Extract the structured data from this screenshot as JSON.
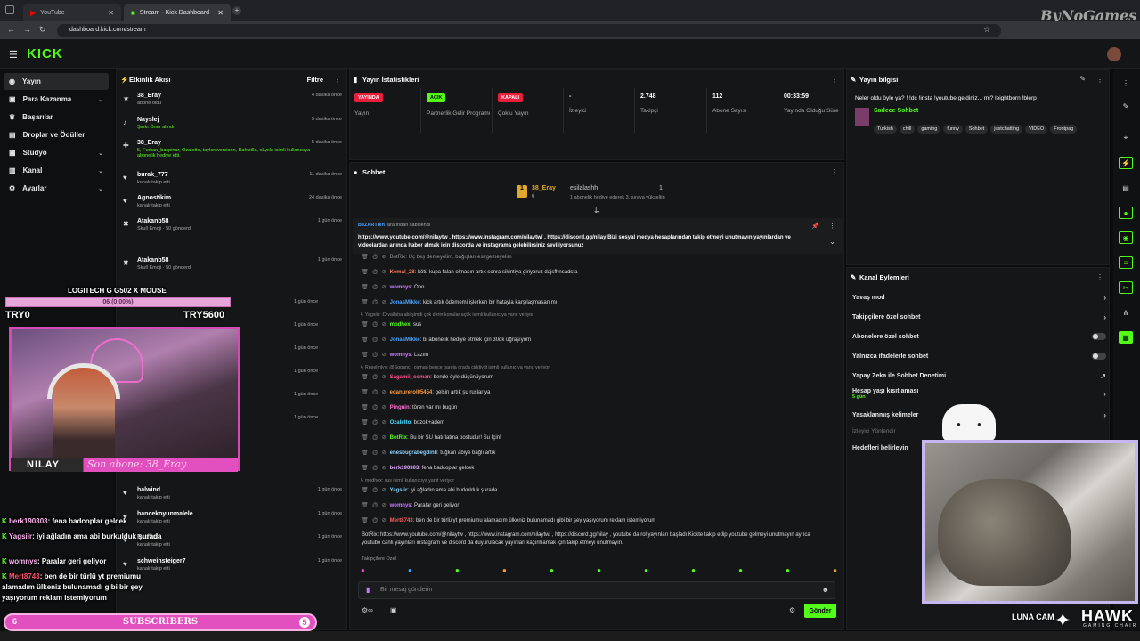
{
  "browser": {
    "tabs": [
      {
        "label": "YouTube"
      },
      {
        "label": "Stream - Kick Dashboard"
      }
    ],
    "url": "dashboard.kick.com/stream"
  },
  "brand": {
    "logo": "KICK"
  },
  "sidebar": {
    "items": [
      {
        "label": "Yayın",
        "icon": "broadcast-icon"
      },
      {
        "label": "Para Kazanma",
        "icon": "money-icon"
      },
      {
        "label": "Başarılar",
        "icon": "trophy-icon"
      },
      {
        "label": "Droplar ve Ödüller",
        "icon": "gift-icon"
      },
      {
        "label": "Stüdyo",
        "icon": "studio-icon"
      },
      {
        "label": "Kanal",
        "icon": "channel-icon"
      },
      {
        "label": "Ayarlar",
        "icon": "gear-icon"
      }
    ]
  },
  "activity": {
    "title": "Etkinlik Akışı",
    "filter": "Filtre",
    "items": [
      {
        "name": "38_Eray",
        "sub": "abone oldu",
        "time": "4 dakika önce"
      },
      {
        "name": "Nayslej",
        "sub": "Şarkı Öner alındı",
        "time": "5 dakika önce"
      },
      {
        "name": "38_Eray",
        "sub": "5, Furkan_baspinar, Ozaletto, taylorsversionn, Bahtzilla, xLyxla isimli kullanıcıya abonelik hediye etti.",
        "time": "5 dakika önce"
      },
      {
        "name": "burak_777",
        "sub": "kanalı takip etti",
        "time": "11 dakika önce"
      },
      {
        "name": "Agnostikim",
        "sub": "kanalı takip etti",
        "time": "24 dakika önce"
      },
      {
        "name": "Atakanb58",
        "sub": "Skull Emoji · 50 gönderdi",
        "time": "1 gün önce"
      },
      {
        "name": "Atakanb58",
        "sub": "Skull Emoji · 50 gönderdi",
        "time": "1 gün önce"
      },
      {
        "name": "halwind",
        "sub": "kanalı takip etti",
        "time": "1 gün önce"
      },
      {
        "name": "hancekoyunmalele",
        "sub": "kanalı takip etti",
        "time": "1 gün önce"
      },
      {
        "name": "Redbul",
        "sub": "kanalı takip etti",
        "time": "1 gün önce"
      },
      {
        "name": "schweinsteiger7",
        "sub": "kanalı takip etti",
        "time": "1 gün önce"
      }
    ],
    "extra_times": [
      "1 gün önce",
      "1 gün önce",
      "1 gün önce",
      "1 gün önce",
      "1 gün önce",
      "1 gün önce"
    ]
  },
  "stats": {
    "title": "Yayın İstatistikleri",
    "items": [
      {
        "badge": "YAYINDA",
        "label": "Yayın",
        "color": "#e91e3a"
      },
      {
        "badge": "AÇIK",
        "label": "Partnerlik Gelir Programı",
        "color": "#53fc18"
      },
      {
        "badge": "KAPALI",
        "label": "Çoklu Yayın",
        "color": "#e91e3a"
      },
      {
        "value": "-",
        "label": "İzleyici"
      },
      {
        "value": "2.748",
        "label": "Takipçi"
      },
      {
        "value": "112",
        "label": "Abone Sayısı"
      },
      {
        "value": "00:33:59",
        "label": "Yayında Olduğu Süre"
      }
    ]
  },
  "chat": {
    "title": "Sohbet",
    "leaderboard": {
      "first_name": "38_Eray",
      "first_count": "6",
      "second_name": "esilalashh",
      "second_count": "1",
      "second_note": "1 abonelik hediye ederek 3. sıraya yükseltin"
    },
    "pinned": {
      "by": "BeZARTbin",
      "by_suffix": "tarafından sabitlendi",
      "text": "https://www.youtube.com/@nilaytw , https://www.instagram.com/nilaytw/ , https://discord.gg/nilay Bizi sosyal medya hesaplarından takip etmeyi unutmayın yayınlardan ve videolardan anında haber almak için discorda ve instagrama gelebilirsiniz seviliyorsunuz"
    },
    "messages": [
      {
        "user": "Kemal_28",
        "color": "#ff7a5c",
        "text": "kötü kupa falan olmasın artık sonra sikintiya giriyoruz dajsfhnsadsfa"
      },
      {
        "user": "womnys",
        "color": "#c77dff",
        "text": "Ooo"
      },
      {
        "user": "JonasMikke",
        "color": "#4aa3ff",
        "text": "kick artık ödememi işlerken bir hatayla karşılaşmasan mı"
      },
      {
        "user": "modhex",
        "color": "#53fc18",
        "text": "sus"
      },
      {
        "user": "JonasMikke",
        "color": "#4aa3ff",
        "text": "bi abonelik hediye etmek için 30dk uğraşıyom"
      },
      {
        "user": "womnys",
        "color": "#c77dff",
        "text": "Lazım"
      },
      {
        "user": "Sagamii_osman",
        "color": "#ff4f8b",
        "text": "bende öyle düşünüyorum"
      },
      {
        "user": "edanurerol05454",
        "color": "#ff9a3c",
        "text": "gelsin artık şu ruslar ya"
      },
      {
        "user": "Pinguin",
        "color": "#ff6fcf",
        "text": "tören var mı bugün"
      },
      {
        "user": "Ozaletto",
        "color": "#4ad9ff",
        "text": "bozok+adem"
      },
      {
        "user": "BotRix",
        "color": "#53fc18",
        "text": "Bu bir SU hatırlatma postudur! Su İçin!"
      },
      {
        "user": "enesbugrabegdinli",
        "color": "#8cd3ff",
        "text": "tuğkan abiye bağlı artık"
      },
      {
        "user": "berk190303",
        "color": "#e0a8ff",
        "text": "fena badcoplar gelcek"
      },
      {
        "user": "Yagsiir",
        "color": "#7fd4ff",
        "text": "iyi ağladın ama abi burkulduk şurada"
      },
      {
        "user": "womnys",
        "color": "#c77dff",
        "text": "Paralar geri geliyor"
      },
      {
        "user": "Mert8743",
        "color": "#ff5c5c",
        "text": "ben de bir türlü yt premiumu alamadım ülkeniz bulunamadı gibi bir şey yaşıyorum reklam istemiyorum"
      }
    ],
    "top_partial": "BotRix: Üç beş demeyelim, bağışları esirgemeyelim",
    "replies": [
      "Yagsiir: :D vallaha abi şimdi çok derin konular açtık isimli kullanıcıya yanıt veriyor",
      "Roselmlyy: @Soganci_osman bence pareja orada ciddiydi isimli kullanıcıya yanıt veriyor",
      "modhex: sus isimli kullanıcıya yanıt veriyor"
    ],
    "botrix_last": "BotRix: https://www.youtube.com/@nilaytw , https://www.instagram.com/nilaytw/ , https://discord.gg/nilay , youtube da rol yayınları başladı Kickte takip edip youtube gelmeyi unutmayın ayrıca youtube canlı yayınları instagram ve discord da duyurulacak yayınları kaçırmamak için takip etmeyi unutmayın.",
    "follower_only": "Takipçilere Özel",
    "placeholder": "Bir mesaj gönderin",
    "send": "Gönder"
  },
  "stream_info": {
    "title": "Yayın bilgisi",
    "stream_title": "Neler oldu öyle ya? ! !dc !insta !youtube geldiniz... mi? leightborn !blerp",
    "category": "Sadece Sohbet",
    "tags": [
      "Turkish",
      "chill",
      "gaming",
      "funny",
      "Sohbet",
      "justchatting",
      "VIDEO",
      "Frontpag"
    ]
  },
  "channel_actions": {
    "title": "Kanal Eylemleri",
    "rows": [
      {
        "label": "Yavaş mod",
        "kind": "chevron"
      },
      {
        "label": "Takipçilere özel sohbet",
        "kind": "chevron"
      },
      {
        "label": "Abonelere özel sohbet",
        "kind": "toggle"
      },
      {
        "label": "Yalnızca ifadelerle sohbet",
        "kind": "toggle"
      },
      {
        "label": "Yapay Zeka ile Sohbet Denetimi",
        "kind": "link"
      },
      {
        "label": "Hesap yaşı kısıtlaması",
        "sub": "5 gün",
        "kind": "chevron"
      },
      {
        "label": "Yasaklanmış kelimeler",
        "kind": "chevron"
      },
      {
        "label": "İzleyici Yönlendir",
        "kind": "muted"
      },
      {
        "label": "Hedefleri belirleyin",
        "kind": "plain"
      }
    ]
  },
  "overlay": {
    "mouse_label": "LOGITECH G G502 X MOUSE",
    "progress_text": "06 (0.00%)",
    "progress_fraction": 0.0,
    "try_left": "TRY0",
    "try_right": "TRY5600",
    "name_plate": "NILAY",
    "last_sub": "Son abone: 38_Eray",
    "chat": [
      {
        "user": "berk190303",
        "text": ": fena badcoplar gelcek"
      },
      {
        "user": "Yagsiir",
        "text": ": iyi ağladın ama abi burkulduk şurada"
      },
      {
        "user": "womnys",
        "text": ": Paralar geri geliyor"
      },
      {
        "user": "Mert8743",
        "text": ": ben de bir türlü yt premiumu alamadım ülkeniz bulunamadı gibi bir şey yaşıyorum reklam istemiyorum"
      }
    ],
    "subs_left": "6",
    "subs_label": "SUBSCRIBERS",
    "subs_right": "5",
    "luna_cam": "LUNA CAM",
    "hawk": "HAWK",
    "hawk_sub": "GAMING CHAIR",
    "watermark": "ByNoGames"
  },
  "colors": {
    "accent": "#53fc18",
    "live": "#e91e3a",
    "pink": "#e24fbf"
  }
}
